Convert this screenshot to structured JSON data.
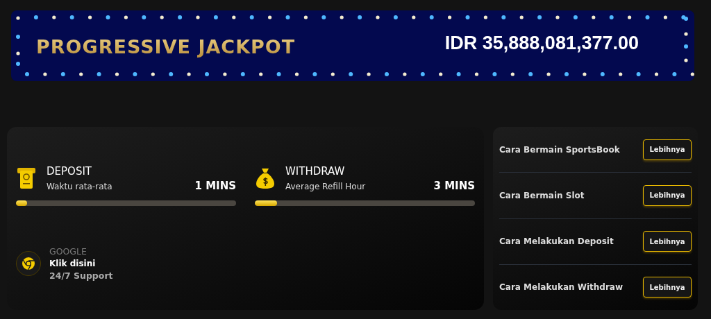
{
  "jackpot": {
    "title": "PROGRESSIVE JACKPOT",
    "amount": "IDR 35,888,081,377.00"
  },
  "stats": [
    {
      "kind": "deposit",
      "title": "DEPOSIT",
      "subtitle": "Waktu rata-rata",
      "value": "1 MINS",
      "level": 0.05
    },
    {
      "kind": "withdraw",
      "title": "WITHDRAW",
      "subtitle": "Average Refill Hour",
      "value": "3 MINS",
      "level": 0.1
    }
  ],
  "support": {
    "label": "GOOGLE",
    "link": "Klik disini",
    "note": "24/7 Support"
  },
  "guides": [
    {
      "title": "Cara Bermain SportsBook",
      "button": "Lebihnya"
    },
    {
      "title": "Cara Bermain Slot",
      "button": "Lebihnya"
    },
    {
      "title": "Cara Melakukan Deposit",
      "button": "Lebihnya"
    },
    {
      "title": "Cara Melakukan Withdraw",
      "button": "Lebihnya"
    }
  ]
}
